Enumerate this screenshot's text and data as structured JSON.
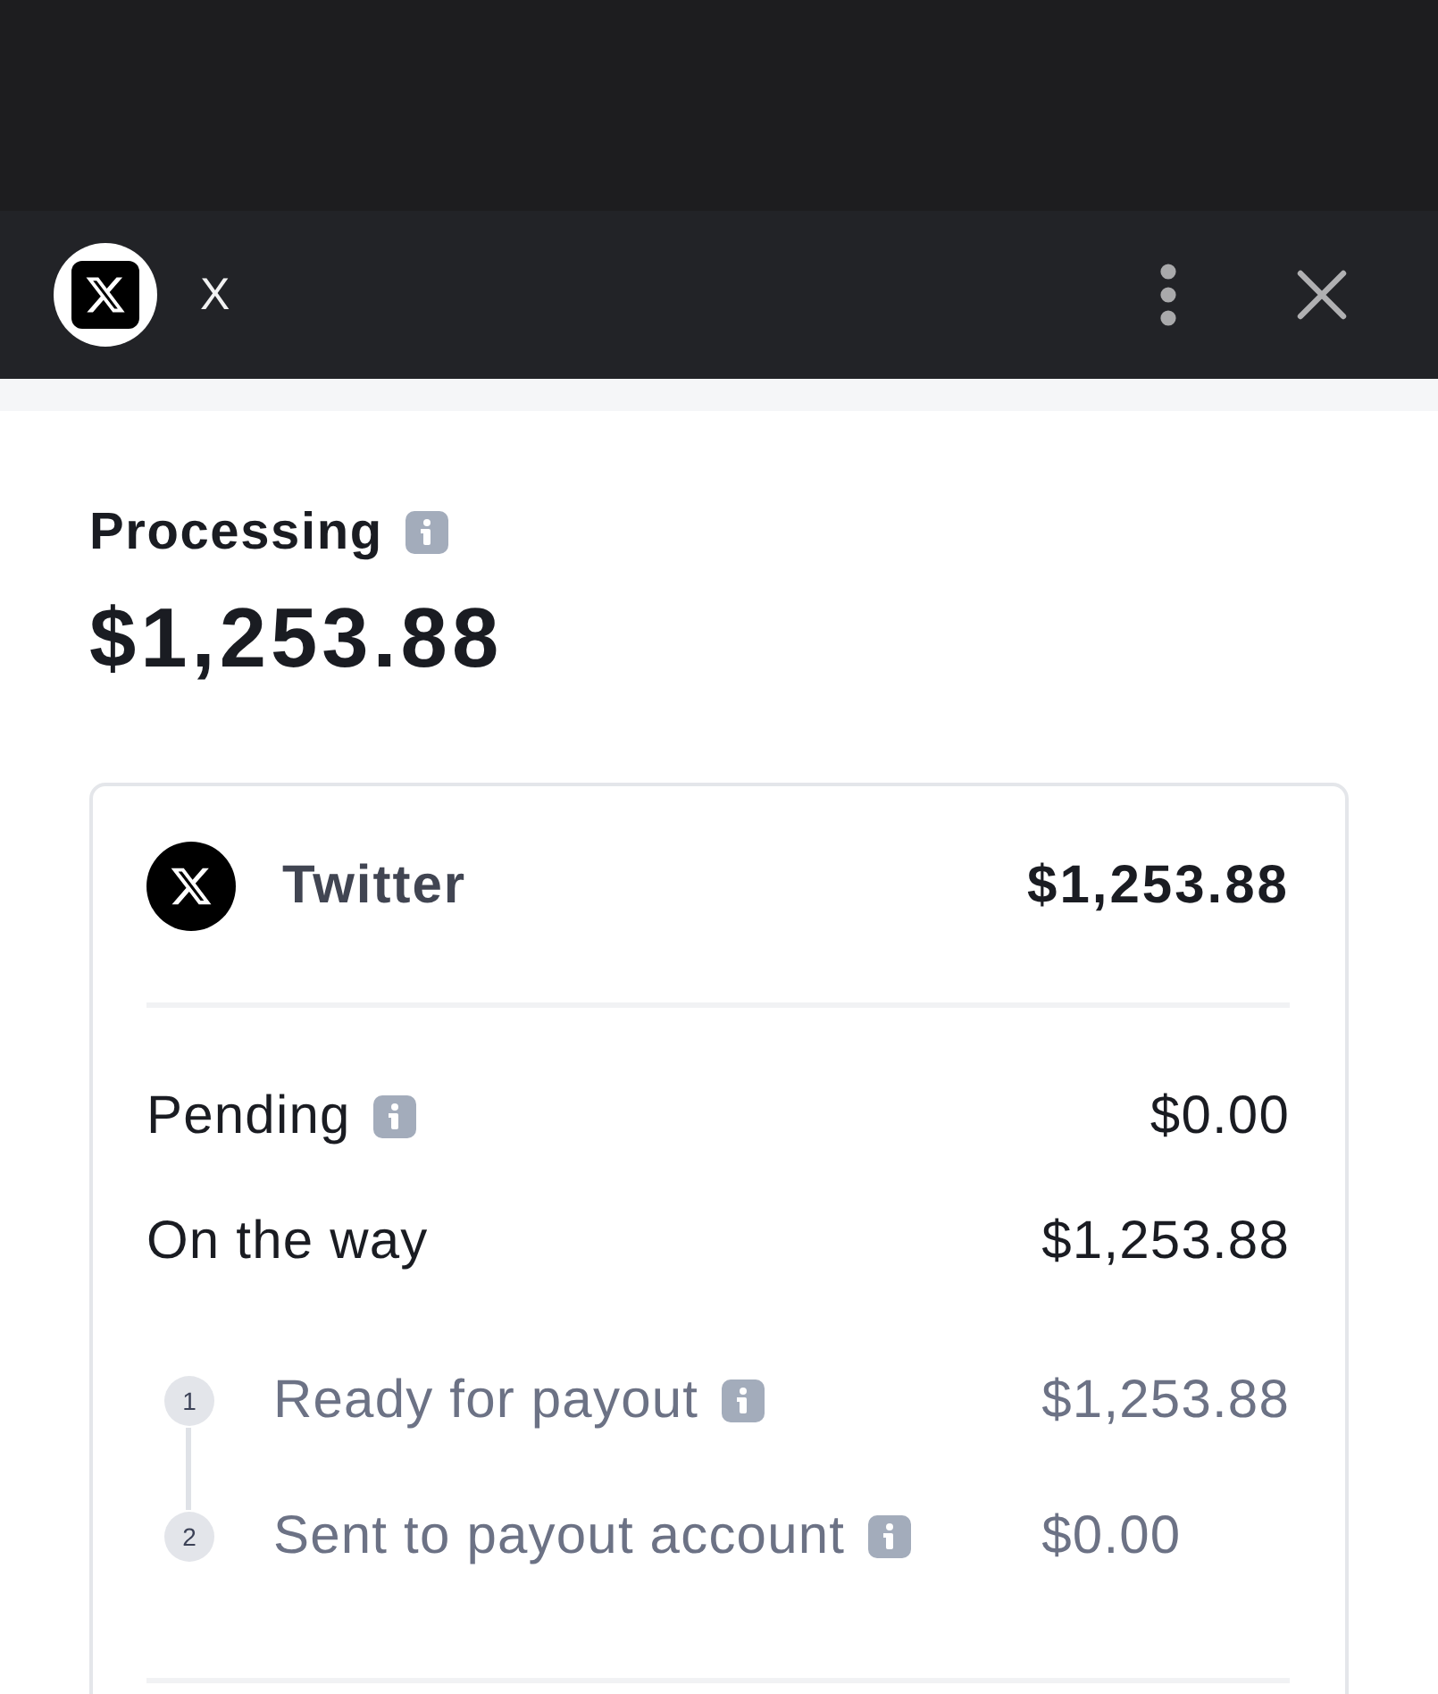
{
  "header": {
    "title": "X"
  },
  "summary": {
    "label": "Processing",
    "amount": "$1,253.88"
  },
  "card": {
    "account": {
      "name": "Twitter",
      "amount": "$1,253.88"
    },
    "rows": [
      {
        "label": "Pending",
        "info": true,
        "amount": "$0.00"
      },
      {
        "label": "On the way",
        "info": false,
        "amount": "$1,253.88"
      }
    ],
    "steps": [
      {
        "number": "1",
        "label": "Ready for payout",
        "info": true,
        "amount": "$1,253.88"
      },
      {
        "number": "2",
        "label": "Sent to payout account",
        "info": true,
        "amount": "$0.00"
      }
    ]
  }
}
